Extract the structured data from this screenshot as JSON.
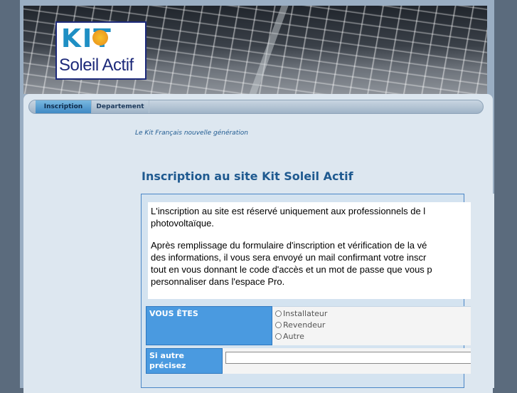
{
  "logo": {
    "kit_text": "KIT",
    "name_text": "Soleil Actif"
  },
  "tabs": [
    {
      "label": "Inscription",
      "active": true
    },
    {
      "label": "Departement",
      "active": false
    }
  ],
  "tagline": "Le Kit Français nouvelle génération",
  "page_title": "Inscription au site Kit Soleil Actif",
  "intro": {
    "para1_lines": [
      "L'inscription au site est réservé uniquement aux professionnels de l",
      "photovoltaïque."
    ],
    "para2_lines": [
      "Après remplissage du formulaire d'inscription et vérification de la vé",
      "des informations, il vous sera envoyé un mail confirmant votre inscr",
      "tout en vous donnant le code d'accès et un mot de passe que vous p",
      "personnaliser dans l'espace Pro."
    ]
  },
  "form": {
    "vous_etes_label": "VOUS ÊTES",
    "options": [
      "Installateur",
      "Revendeur",
      "Autre"
    ],
    "si_autre_label_line1": "Si autre",
    "si_autre_label_line2": "précisez",
    "si_autre_value": ""
  },
  "colors": {
    "accent": "#4a9ae0",
    "title": "#1f5a90",
    "page_bg": "#5b6b7d",
    "panel_bg": "#dde7f0"
  }
}
